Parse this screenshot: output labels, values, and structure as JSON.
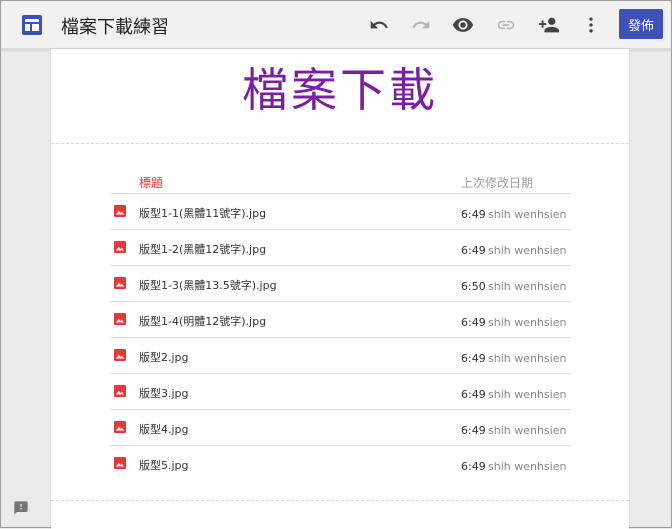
{
  "app": {
    "title": "檔案下載練習",
    "publish_label": "發佈",
    "accent": "#3f51b5"
  },
  "toolbar": {
    "icons": [
      "undo-icon",
      "redo-icon",
      "preview-icon",
      "link-icon",
      "add-person-icon",
      "more-vert-icon"
    ]
  },
  "page": {
    "heading": "檔案下載",
    "heading_color": "#7b1fa2"
  },
  "file_list": {
    "col_title": "標題",
    "col_modified": "上次修改日期",
    "rows": [
      {
        "name": "版型1-1(黑體11號字).jpg",
        "time": "6:49",
        "user": "shih wenhsien"
      },
      {
        "name": "版型1-2(黑體12號字).jpg",
        "time": "6:49",
        "user": "shih wenhsien"
      },
      {
        "name": "版型1-3(黑體13.5號字).jpg",
        "time": "6:50",
        "user": "shih wenhsien"
      },
      {
        "name": "版型1-4(明體12號字).jpg",
        "time": "6:49",
        "user": "shih wenhsien"
      },
      {
        "name": "版型2.jpg",
        "time": "6:49",
        "user": "shih wenhsien"
      },
      {
        "name": "版型3.jpg",
        "time": "6:49",
        "user": "shih wenhsien"
      },
      {
        "name": "版型4.jpg",
        "time": "6:49",
        "user": "shih wenhsien"
      },
      {
        "name": "版型5.jpg",
        "time": "6:49",
        "user": "shih wenhsien"
      }
    ]
  }
}
